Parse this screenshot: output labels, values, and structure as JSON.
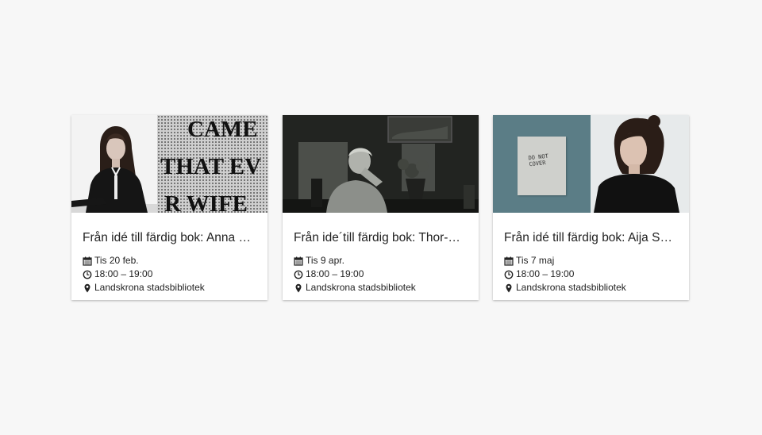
{
  "events": [
    {
      "title": "Från idé till färdig bok: Anna N…",
      "date": "Tis 20 feb.",
      "time": "18:00 – 19:00",
      "location": "Landskrona stadsbibliotek",
      "image_text": [
        "CAME",
        "THAT EV",
        "R WIFE"
      ]
    },
    {
      "title": "Från ide´till färdig bok: Thor-Bj…",
      "date": "Tis 9 apr.",
      "time": "18:00 – 19:00",
      "location": "Landskrona stadsbibliotek"
    },
    {
      "title": "Från idé till färdig bok: Aija Sve…",
      "date": "Tis 7 maj",
      "time": "18:00 – 19:00",
      "location": "Landskrona stadsbibliotek",
      "image_text": [
        "DO NOT",
        "COVER"
      ]
    }
  ],
  "icons": {
    "date": "calendar-icon",
    "time": "clock-icon",
    "location": "map-marker-icon"
  }
}
